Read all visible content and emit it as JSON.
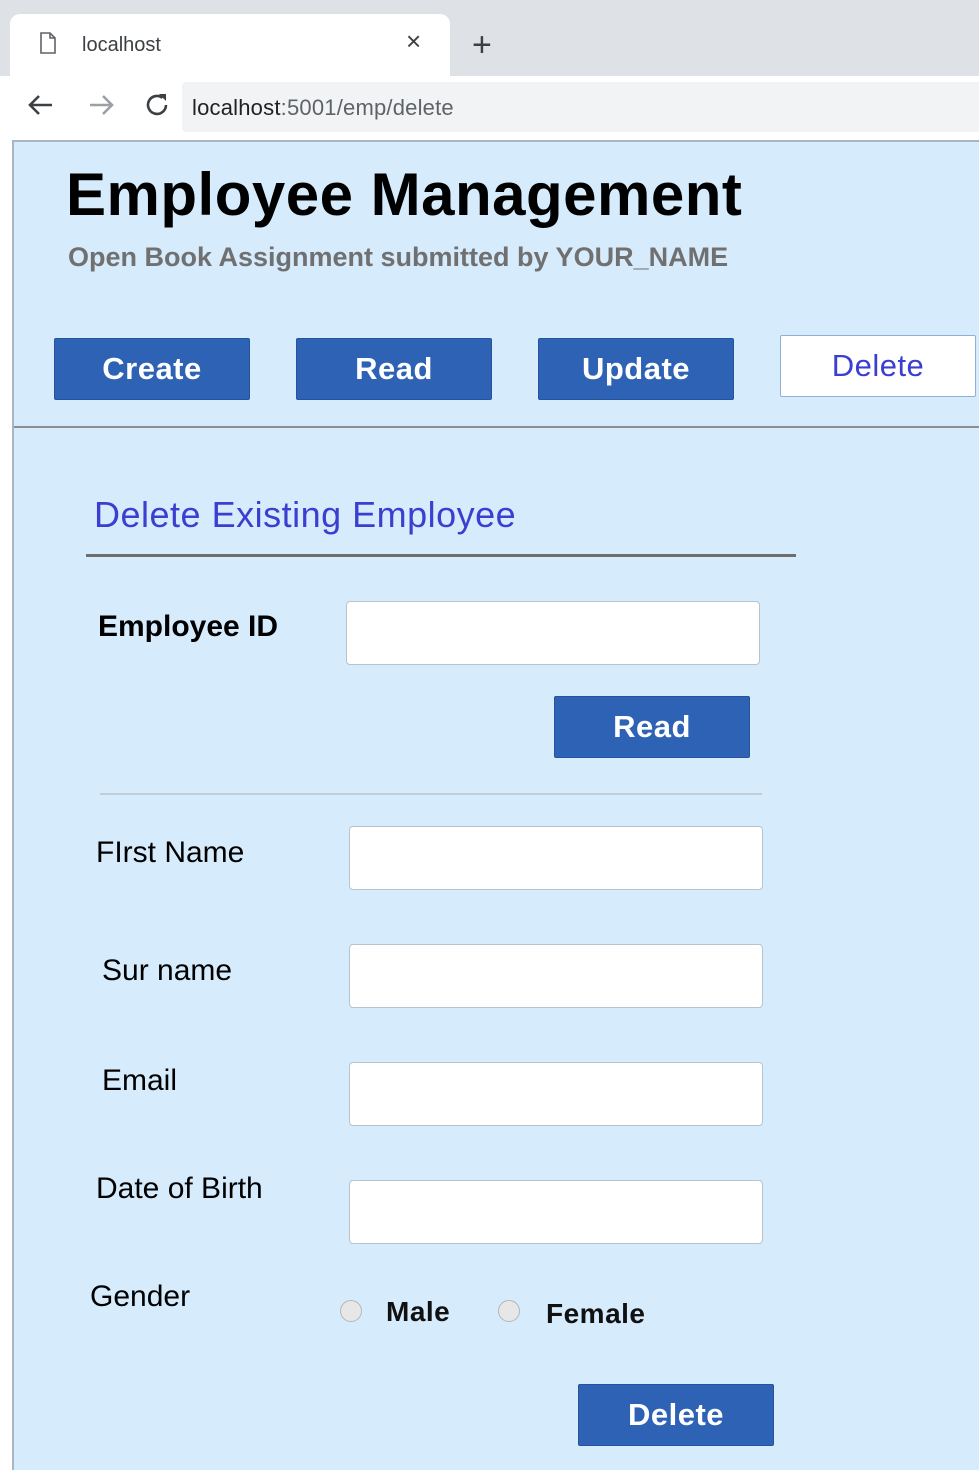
{
  "browser": {
    "tab_title": "localhost",
    "tab_close": "×",
    "new_tab": "+",
    "url_host": "localhost",
    "url_path": ":5001/emp/delete"
  },
  "header": {
    "title": "Employee Management",
    "subtitle": "Open Book Assignment submitted by YOUR_NAME"
  },
  "nav": {
    "create": "Create",
    "read": "Read",
    "update": "Update",
    "delete": "Delete",
    "active": "Delete"
  },
  "form": {
    "section_title": "Delete Existing Employee",
    "employee_id_label": "Employee ID",
    "employee_id_value": "",
    "read_button": "Read",
    "first_name_label": "FIrst Name",
    "first_name_value": "",
    "surname_label": "Sur name",
    "surname_value": "",
    "email_label": "Email",
    "email_value": "",
    "dob_label": "Date of Birth",
    "dob_value": "",
    "gender_label": "Gender",
    "gender_options": [
      "Male",
      "Female"
    ],
    "delete_button": "Delete"
  },
  "colors": {
    "page_background": "#d6ebfc",
    "button_blue": "#2d62b4",
    "accent_text": "#3a3fd0"
  }
}
